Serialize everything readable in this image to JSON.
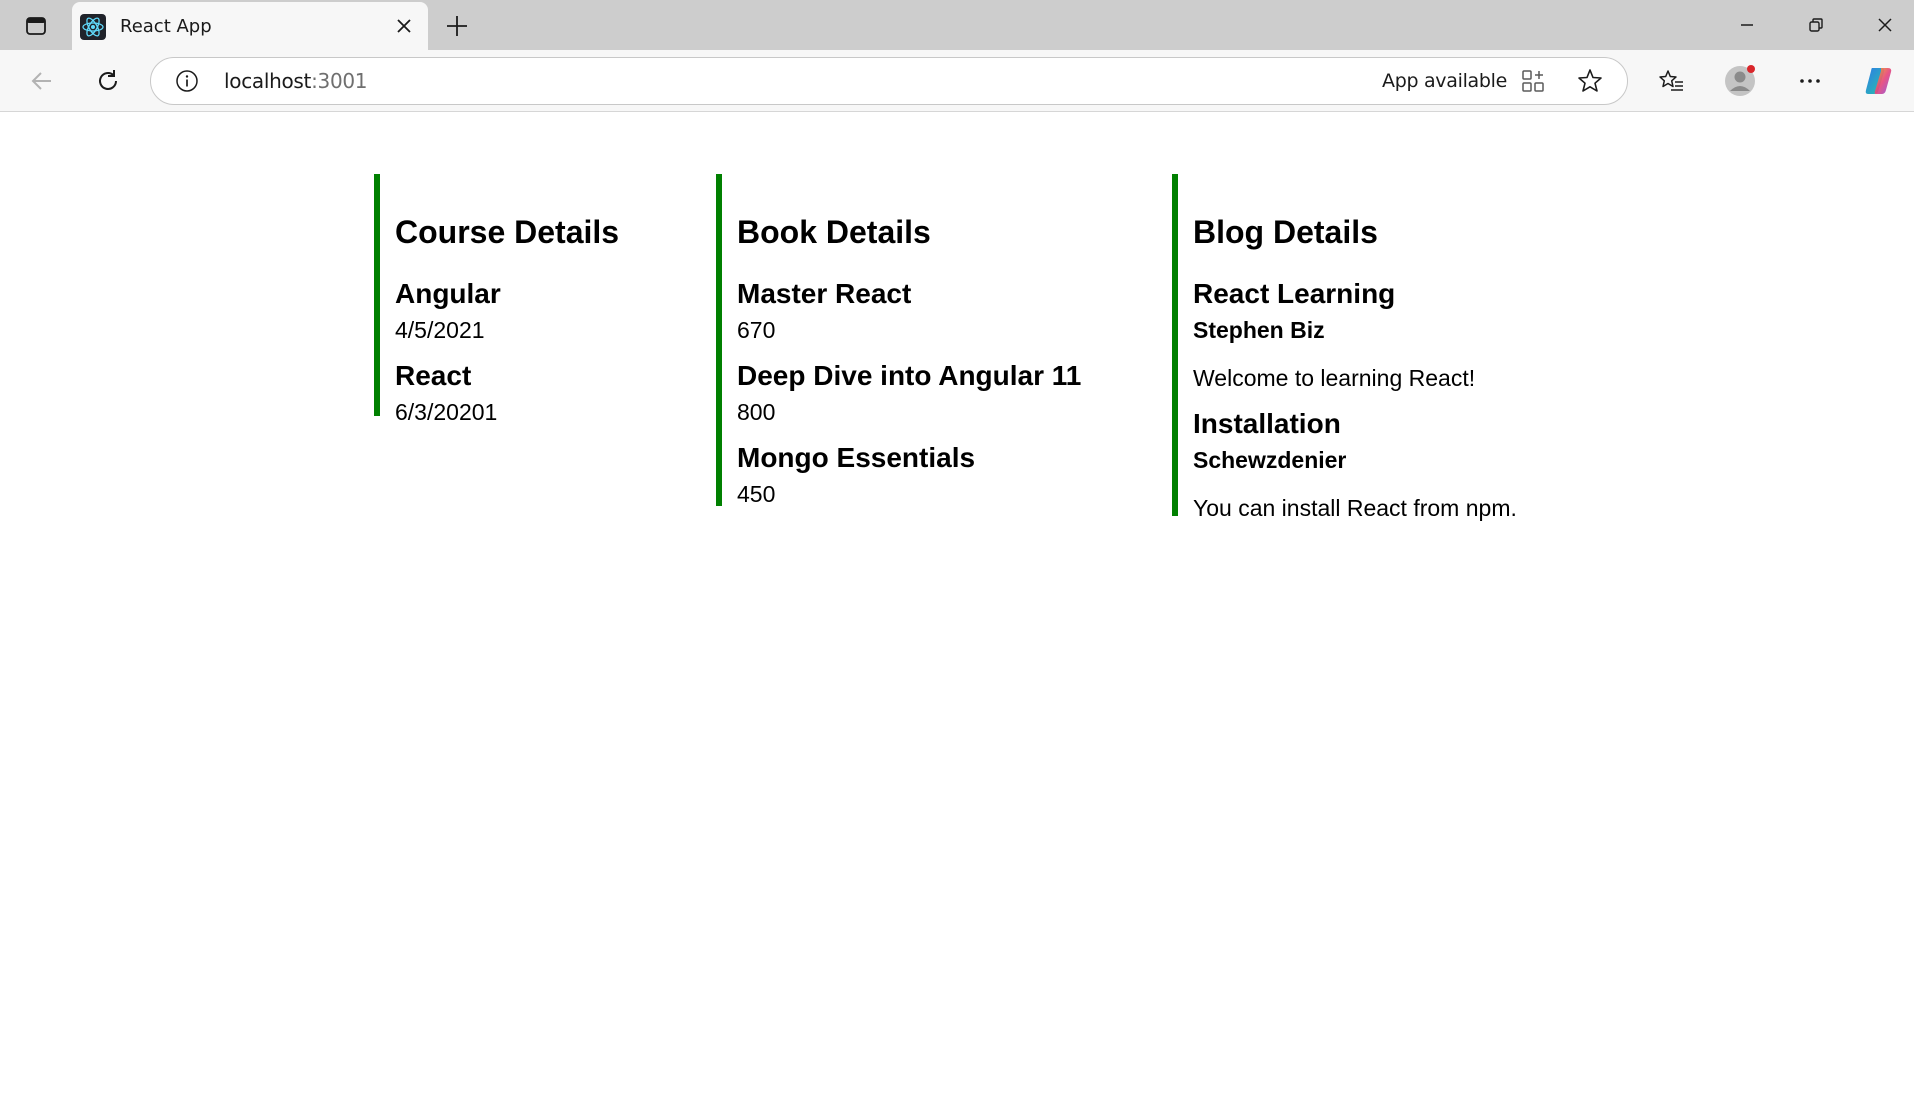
{
  "browser": {
    "tab": {
      "title": "React App",
      "favicon": "react-logo-icon"
    },
    "address": {
      "host": "localhost",
      "port": ":3001"
    },
    "app_available_label": "App available",
    "icons": {
      "tab_actions": "tab-actions-icon",
      "close_tab": "close-icon",
      "new_tab": "plus-icon",
      "back": "back-arrow-icon",
      "refresh": "refresh-icon",
      "site_info": "info-icon",
      "install_app": "app-install-icon",
      "favorite": "star-icon",
      "favorites": "favorites-list-icon",
      "profile": "profile-avatar-icon",
      "more": "more-dots-icon",
      "copilot": "copilot-icon"
    },
    "accent_color": "#008000"
  },
  "course": {
    "heading": "Course Details",
    "items": [
      {
        "name": "Angular",
        "date": "4/5/2021"
      },
      {
        "name": "React",
        "date": "6/3/20201"
      }
    ]
  },
  "book": {
    "heading": "Book Details",
    "items": [
      {
        "name": "Master React",
        "price": "670"
      },
      {
        "name": "Deep Dive into Angular 11",
        "price": "800"
      },
      {
        "name": "Mongo Essentials",
        "price": "450"
      }
    ]
  },
  "blog": {
    "heading": "Blog Details",
    "items": [
      {
        "title": "React Learning",
        "author": "Stephen Biz",
        "body": "Welcome to learning React!"
      },
      {
        "title": "Installation",
        "author": "Schewzdenier",
        "body": "You can install React from npm."
      }
    ]
  }
}
